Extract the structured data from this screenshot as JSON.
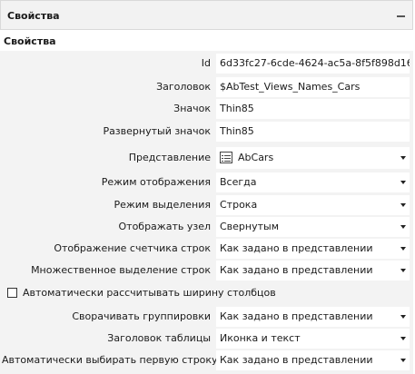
{
  "panel": {
    "title": "Свойства"
  },
  "section": {
    "title": "Свойства"
  },
  "properties": [
    {
      "label": "Id",
      "value": "6d33fc27-6cde-4624-ac5a-8f5f898d16",
      "dropdown": false
    },
    {
      "label": "Заголовок",
      "value": "$AbTest_Views_Names_Cars",
      "dropdown": false
    },
    {
      "label": "Значок",
      "value": "Thin85",
      "dropdown": false
    },
    {
      "label": "Развернутый значок",
      "value": "Thin85",
      "dropdown": false
    },
    {
      "label": "Представление",
      "value": "AbCars",
      "dropdown": true,
      "icon": "table-view-icon"
    },
    {
      "label": "Режим отображения",
      "value": "Всегда",
      "dropdown": true
    },
    {
      "label": "Режим выделения",
      "value": "Строка",
      "dropdown": true
    },
    {
      "label": "Отображать узел",
      "value": "Свернутым",
      "dropdown": true
    },
    {
      "label": "Отображение счетчика строк",
      "value": "Как задано в представлении",
      "dropdown": true
    },
    {
      "label": "Множественное выделение строк",
      "value": "Как задано в представлении",
      "dropdown": true
    }
  ],
  "checkbox": {
    "label": "Автоматически рассчитывать ширину столбцов",
    "checked": false
  },
  "properties_after": [
    {
      "label": "Сворачивать группировки",
      "value": "Как задано в представлении",
      "dropdown": true
    },
    {
      "label": "Заголовок таблицы",
      "value": "Иконка и текст",
      "dropdown": true
    },
    {
      "label": "Автоматически выбирать первую строку",
      "value": "Как задано в представлении",
      "dropdown": true
    }
  ]
}
